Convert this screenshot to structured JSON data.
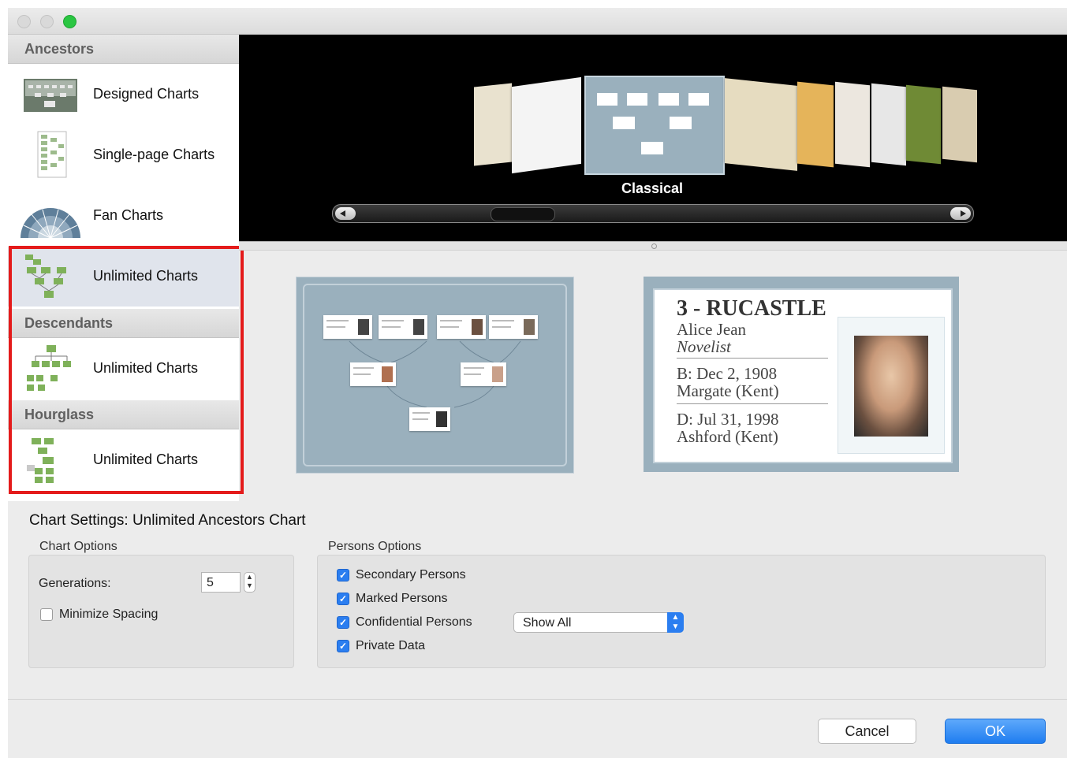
{
  "sidebar": {
    "sections": [
      {
        "title": "Ancestors"
      },
      {
        "title": "Descendants"
      },
      {
        "title": "Hourglass"
      }
    ],
    "items": [
      {
        "label": "Designed Charts"
      },
      {
        "label": "Single-page Charts"
      },
      {
        "label": "Fan Charts"
      },
      {
        "label": "Unlimited Charts"
      },
      {
        "label": "Unlimited Charts"
      },
      {
        "label": "Unlimited Charts"
      }
    ]
  },
  "carousel": {
    "caption": "Classical"
  },
  "preview_card": {
    "title": "3 - RUCASTLE",
    "name": "Alice Jean",
    "occupation": "Novelist",
    "birth_date": "B: Dec 2, 1908",
    "birth_place": "Margate (Kent)",
    "death_date": "D: Jul 31, 1998",
    "death_place": "Ashford (Kent)"
  },
  "settings": {
    "title": "Chart Settings: Unlimited Ancestors Chart",
    "chart_options": {
      "label": "Chart Options",
      "generations_label": "Generations:",
      "generations_value": "5",
      "minimize_spacing_label": "Minimize Spacing",
      "minimize_spacing_checked": false
    },
    "persons_options": {
      "label": "Persons Options",
      "secondary_persons": "Secondary Persons",
      "marked_persons": "Marked Persons",
      "confidential_persons": "Confidential Persons",
      "confidential_select": "Show All",
      "private_data": "Private Data"
    }
  },
  "buttons": {
    "cancel": "Cancel",
    "ok": "OK"
  },
  "colors": {
    "accent": "#2b7ef0",
    "highlight_border": "#e41b1b",
    "preview_bg": "#9ab0bd"
  }
}
